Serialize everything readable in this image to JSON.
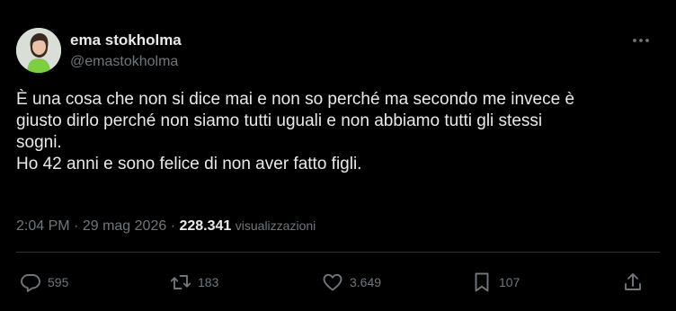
{
  "author": {
    "display_name": "ema stokholma",
    "handle": "@emastokholma"
  },
  "tweet": {
    "lines": [
      "È una cosa che non si dice mai e non so perché ma secondo me invece è",
      "giusto dirlo perché non siamo tutti uguali e non abbiamo tutti gli stessi",
      "sogni.",
      "Ho 42 anni e sono felice di non aver fatto figli."
    ],
    "time": "2:04 PM",
    "separator": "·",
    "date": "29 mag 2026",
    "views_count": "228.341",
    "views_label": "visualizzazioni"
  },
  "actions": {
    "replies": "595",
    "retweets": "183",
    "likes": "3.649",
    "bookmarks": "107"
  },
  "icons": {
    "more": "more-horizontal-icon",
    "reply": "reply-bubble-icon",
    "retweet": "retweet-arrows-icon",
    "like": "heart-icon",
    "bookmark": "bookmark-icon",
    "share": "share-upload-icon"
  },
  "colors": {
    "background": "#000000",
    "text_primary": "#e7e9ea",
    "text_secondary": "#71767b",
    "divider": "#2f3336"
  }
}
